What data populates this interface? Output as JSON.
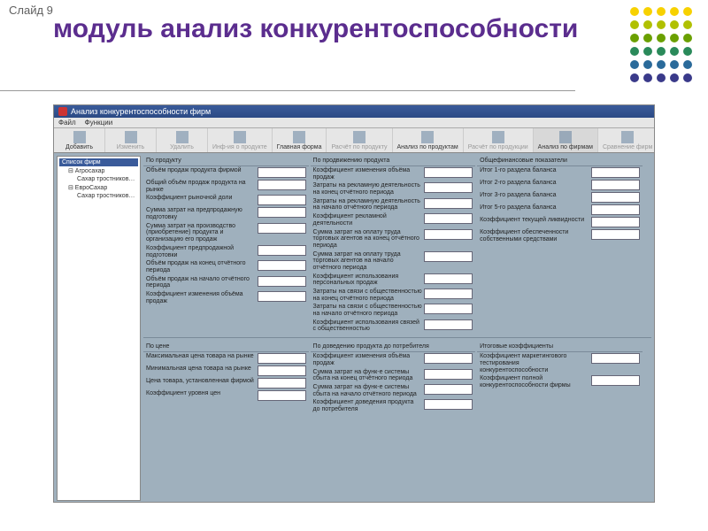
{
  "slideNumber": "Слайд 9",
  "slideTitle": "модуль анализ конкурентоспособности",
  "dotColors": [
    "#f7d100",
    "#f7d100",
    "#f7d100",
    "#f7d100",
    "#f7d100",
    "#b0c000",
    "#b0c000",
    "#b0c000",
    "#b0c000",
    "#b0c000",
    "#6aa000",
    "#6aa000",
    "#6aa000",
    "#6aa000",
    "#6aa000",
    "#2a8a5a",
    "#2a8a5a",
    "#2a8a5a",
    "#2a8a5a",
    "#2a8a5a",
    "#2a6a9a",
    "#2a6a9a",
    "#2a6a9a",
    "#2a6a9a",
    "#2a6a9a",
    "#3a3a8a",
    "#3a3a8a",
    "#3a3a8a",
    "#3a3a8a",
    "#3a3a8a"
  ],
  "window": {
    "title": "Анализ конкурентоспособности фирм",
    "menu": [
      "Файл",
      "Функции"
    ]
  },
  "toolbar": [
    {
      "label": "Добавить",
      "dim": false
    },
    {
      "label": "Изменить",
      "dim": true
    },
    {
      "label": "Удалить",
      "dim": true
    },
    {
      "label": "Инф-ия о продукте",
      "dim": true
    },
    {
      "label": "Главная форма",
      "dim": false
    },
    {
      "label": "Расчёт по продукту",
      "dim": true
    },
    {
      "label": "Анализ по продуктам",
      "dim": false
    },
    {
      "label": "Расчёт по продукции",
      "dim": true
    },
    {
      "label": "Анализ по фирмам",
      "dim": false,
      "active": true
    },
    {
      "label": "Сравнение фирм",
      "dim": true
    }
  ],
  "tree": {
    "root": "Список фирм",
    "nodes": [
      {
        "name": "Агросахар",
        "children": [
          "Сахар тростников…"
        ]
      },
      {
        "name": "ЕвроСахар",
        "children": [
          "Сахар тростников…"
        ]
      }
    ]
  },
  "sectionsTop": [
    {
      "title": "По продукту",
      "fields": [
        "Объём продаж продукта фирмой",
        "Общий объём продаж продукта на рынке",
        "Коэффициент рыночной доли",
        "Сумма затрат на предпродажную подготовку",
        "Сумма затрат на производство (приобретение) продукта и организацию его продаж",
        "Коэффициент предпродажной подготовки",
        "Объём продаж на конец отчётного периода",
        "Объём продаж на начало отчётного периода",
        "Коэффициент изменения объёма продаж"
      ]
    },
    {
      "title": "По продвижению продукта",
      "fields": [
        "Коэффициент изменения объёма продаж",
        "Затраты на рекламную деятельность на конец отчётного периода",
        "Затраты на рекламную деятельность на начало отчётного периода",
        "Коэффициент рекламной деятельности",
        "Сумма затрат на оплату труда торговых агентов на конец отчётного периода",
        "Сумма затрат на оплату труда торговых агентов на начало отчётного периода",
        "Коэффициент использования персональных продаж",
        "Затраты на связи с общественностью на конец отчётного периода",
        "Затраты на связи с общественностью на начало отчётного периода",
        "Коэффициент использования связей с общественностью"
      ]
    },
    {
      "title": "Общефинансовые показатели",
      "fields": [
        "Итог 1-го раздела баланса",
        "Итог 2-го раздела баланса",
        "Итог 3-го раздела баланса",
        "Итог 5-го раздела баланса",
        "Коэффициент текущей ликвидности",
        "Коэффициент обеспеченности собственными средствами"
      ]
    }
  ],
  "sectionsBottom": [
    {
      "title": "По цене",
      "fields": [
        "Максимальная цена товара на рынке",
        "Минимальная цена товара на рынке",
        "Цена товара, установленная фирмой",
        "Коэффициент уровня цен"
      ]
    },
    {
      "title": "По доведению продукта до потребителя",
      "fields": [
        "Коэффициент изменения объёма продаж",
        "Сумма затрат на функ-е системы сбыта на конец отчётного периода",
        "Сумма затрат на функ-е системы сбыта на начало отчётного периода",
        "Коэффициент доведения продукта до потребителя"
      ]
    },
    {
      "title": "Итоговые коэффициенты",
      "fields": [
        "Коэффициент маркетингового тестирования конкурентоспособности",
        "Коэффициент полной конкурентоспособности фирмы"
      ]
    }
  ]
}
